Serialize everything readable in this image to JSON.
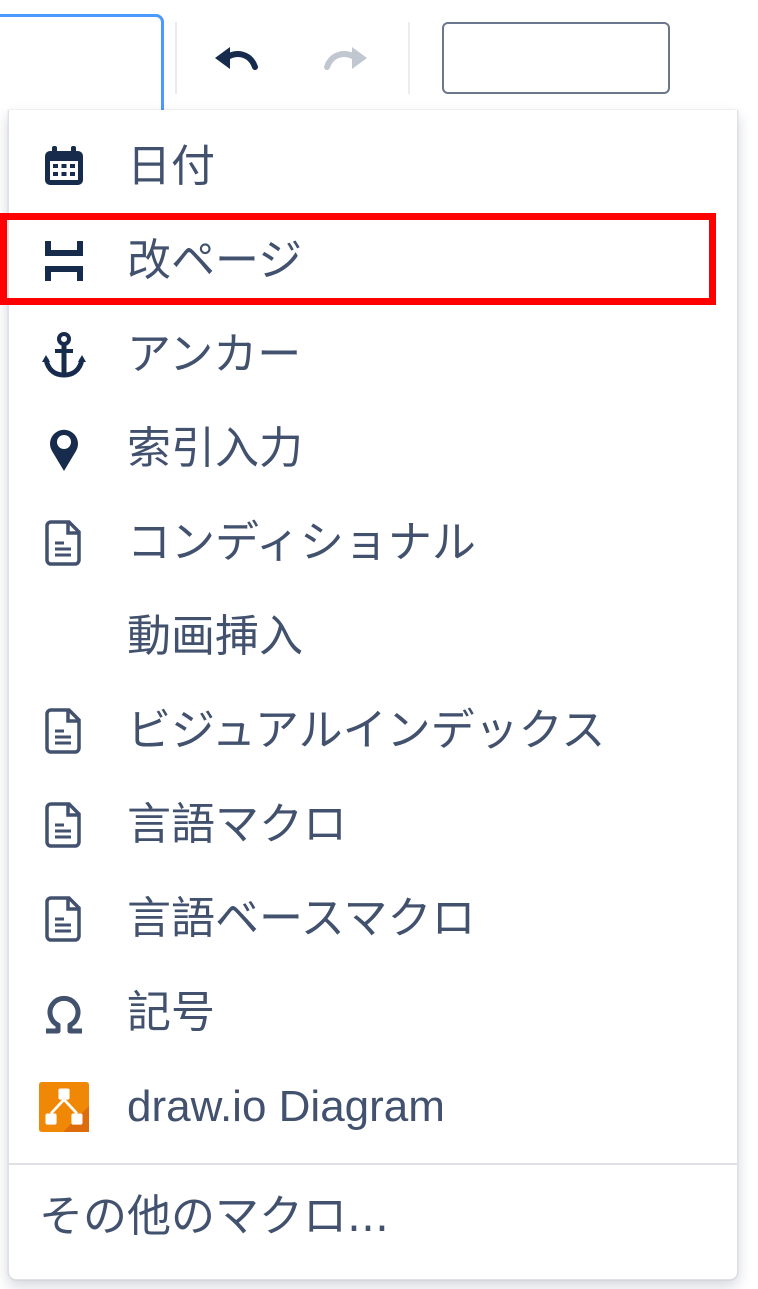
{
  "toolbar": {
    "undo_icon": "undo-icon",
    "redo_icon": "redo-icon"
  },
  "menu": {
    "items": [
      {
        "label": "日付",
        "icon": "calendar-icon"
      },
      {
        "label": "改ページ",
        "icon": "page-break-icon"
      },
      {
        "label": "アンカー",
        "icon": "anchor-icon"
      },
      {
        "label": "索引入力",
        "icon": "map-pin-icon"
      },
      {
        "label": "コンディショナル",
        "icon": "document-icon"
      },
      {
        "label": "動画挿入",
        "icon": ""
      },
      {
        "label": "ビジュアルインデックス",
        "icon": "document-icon"
      },
      {
        "label": "言語マクロ",
        "icon": "document-icon"
      },
      {
        "label": "言語ベースマクロ",
        "icon": "document-icon"
      },
      {
        "label": "記号",
        "icon": "omega-icon"
      },
      {
        "label": "draw.io Diagram",
        "icon": "drawio-icon"
      }
    ],
    "more_label": "その他のマクロ..."
  },
  "colors": {
    "text": "#42526e",
    "icon": "#172b4d",
    "focus_border": "#4c9aff",
    "highlight_border": "#ff0000",
    "drawio_orange": "#f08705"
  }
}
